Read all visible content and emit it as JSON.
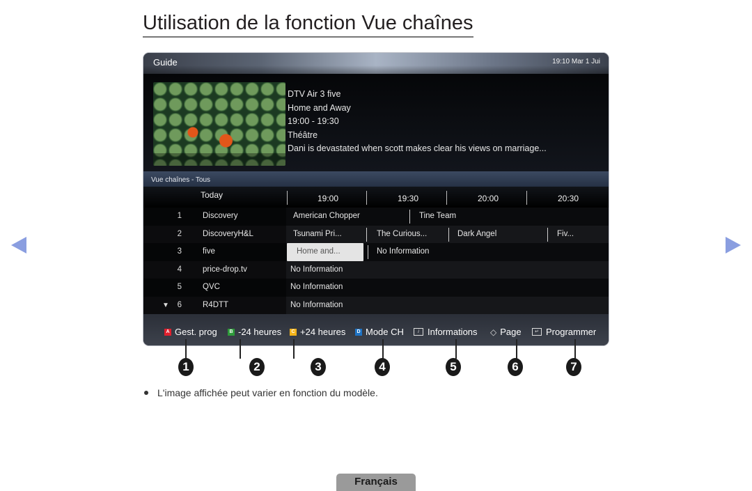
{
  "page": {
    "title": "Utilisation de la fonction Vue chaînes",
    "note": "L'image affichée peut varier en fonction du modèle.",
    "language_tab": "Français",
    "nav": {
      "prev": "previous-page",
      "next": "next-page"
    }
  },
  "tv": {
    "header": {
      "title": "Guide",
      "clock": "19:10 Mar 1 Jui"
    },
    "info": {
      "channel": "DTV Air 3 five",
      "program": "Home and Away",
      "time": "19:00 - 19:30",
      "genre": "Théâtre",
      "description": "Dani is devastated when scott makes clear his views on marriage..."
    },
    "section_label": "Vue chaînes - Tous",
    "timeline": {
      "day": "Today",
      "slots": [
        "19:00",
        "19:30",
        "20:00",
        "20:30"
      ]
    },
    "channels": [
      {
        "num": "1",
        "name": "Discovery",
        "programs": [
          "American Chopper",
          "Tine Team"
        ]
      },
      {
        "num": "2",
        "name": "DiscoveryH&L",
        "programs": [
          "Tsunami Pri...",
          "The Curious...",
          "Dark Angel",
          "Fiv..."
        ]
      },
      {
        "num": "3",
        "name": "five",
        "programs": [
          "Home and...",
          "No Information"
        ],
        "selected": "Home and..."
      },
      {
        "num": "4",
        "name": "price-drop.tv",
        "programs": [
          "No Information"
        ]
      },
      {
        "num": "5",
        "name": "QVC",
        "programs": [
          "No Information"
        ]
      },
      {
        "num": "6",
        "name": "R4DTT",
        "programs": [
          "No Information"
        ],
        "scroll_arrow": "▼"
      }
    ],
    "footer": [
      {
        "key": "A",
        "color": "#e0202e",
        "label": "Gest. prog",
        "callout": "1"
      },
      {
        "key": "B",
        "color": "#2e9a3a",
        "label": "-24 heures",
        "callout": "2"
      },
      {
        "key": "C",
        "color": "#f4b31a",
        "label": "+24 heures",
        "callout": "3"
      },
      {
        "key": "D",
        "color": "#1e73c4",
        "label": "Mode CH",
        "callout": "4"
      },
      {
        "icon": "info-icon",
        "glyph": "i",
        "label": "Informations",
        "callout": "5"
      },
      {
        "icon": "page-updown-icon",
        "glyph": "◇",
        "label": "Page",
        "callout": "6"
      },
      {
        "icon": "schedule-enter-icon",
        "glyph": "↵",
        "label": "Programmer",
        "callout": "7"
      }
    ]
  }
}
